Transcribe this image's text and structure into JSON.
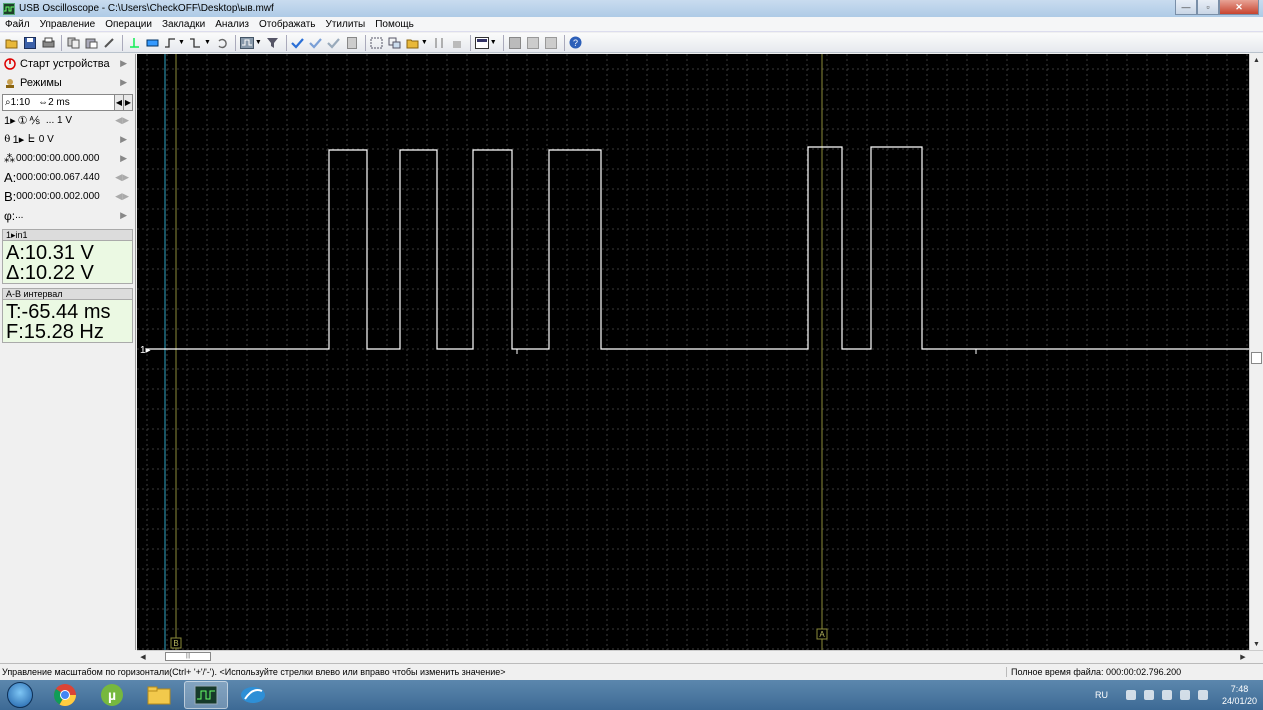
{
  "window": {
    "title": "USB Oscilloscope - C:\\Users\\CheckOFF\\Desktop\\ыв.mwf",
    "controls": [
      "—",
      "▫",
      "✕"
    ]
  },
  "menu": [
    "Файл",
    "Управление",
    "Операции",
    "Закладки",
    "Анализ",
    "Отображать",
    "Утилиты",
    "Помощь"
  ],
  "left_panel": {
    "start_device": "Старт устройства",
    "modes": "Режимы",
    "zoom": "1:10",
    "timebase": "2 ms",
    "channel_scale": "... 1 V",
    "trigger_level": "0 V",
    "time_offset": "000:00:00.000.000",
    "cursor_a": "000:00:00.067.440",
    "cursor_b": "000:00:00.002.000",
    "phi": "...",
    "labels": {
      "ch1": "1▸",
      "a": "A:",
      "b": "B:",
      "phi": "φ:"
    },
    "channel_panel": {
      "header": "1▸in1",
      "value_a": "A:10.31 V",
      "value_delta": "Δ:10.22 V"
    },
    "interval_panel": {
      "header": "A-B интервал",
      "period": "T:-65.44 ms",
      "frequency": "F:15.28 Hz"
    }
  },
  "scope": {
    "channel_marker": "1▸",
    "cursor_b_label": "B",
    "cursor_a_label": "A",
    "trace_color": "#ffffff",
    "grid_color": "#3a3a3a",
    "cursor_color": "#8c8c3a",
    "trigger_line_color": "#2fa8c8"
  },
  "statusbar": {
    "hint": "Управление масштабом по горизонтали(Ctrl+ '+'/'-'). <Используйте стрелки влево или вправо чтобы изменить значение>",
    "file_time": "Полное время файла: 000:00:02.796.200"
  },
  "taskbar": {
    "lang": "RU",
    "time": "7:48",
    "date": "24/01/20"
  }
}
